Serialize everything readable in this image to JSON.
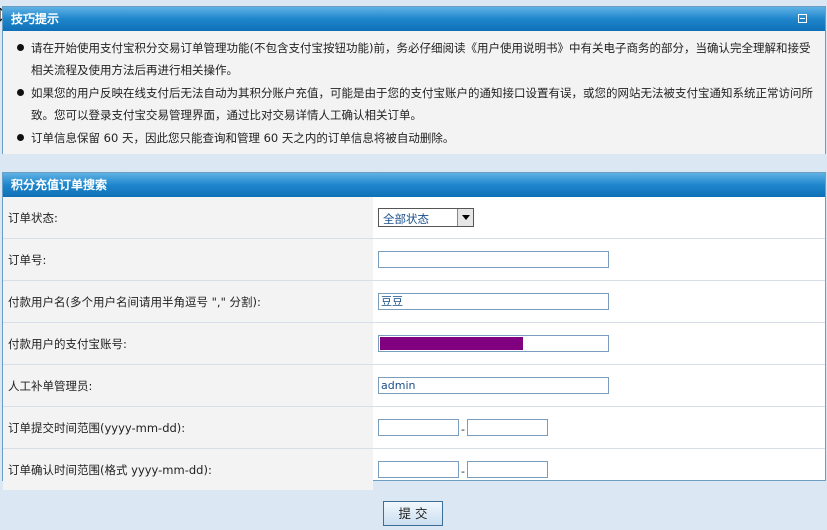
{
  "tips_panel": {
    "title": "技巧提示",
    "items": [
      "请在开始使用支付宝积分交易订单管理功能(不包含支付宝按钮功能)前，务必仔细阅读《用户使用说明书》中有关电子商务的部分，当确认完全理解和接受相关流程及使用方法后再进行相关操作。",
      "如果您的用户反映在线支付后无法自动为其积分账户充值，可能是由于您的支付宝账户的通知接口设置有误，或您的网站无法被支付宝通知系统正常访问所致。您可以登录支付宝交易管理界面，通过比对交易详情人工确认相关订单。",
      "订单信息保留  60 天，因此您只能查询和管理  60 天之内的订单信息将被自动删除。"
    ]
  },
  "search_panel": {
    "title": "积分充值订单搜索",
    "order_status": {
      "label": "订单状态:",
      "selected": "全部状态"
    },
    "order_no": {
      "label": "订单号:",
      "value": ""
    },
    "payer_name": {
      "label": "付款用户名(多个用户名间请用半角逗号 \",\" 分割):",
      "value": "豆豆"
    },
    "payer_alipay": {
      "label": "付款用户的支付宝账号:",
      "value": ""
    },
    "manual_admin": {
      "label": "人工补单管理员:",
      "value": "admin"
    },
    "submit_time_range": {
      "label": "订单提交时间范围(yyyy-mm-dd):",
      "from": "",
      "separator": "-",
      "to": ""
    },
    "confirm_time_range": {
      "label": "订单确认时间范围(格式  yyyy-mm-dd):",
      "from": "",
      "separator": "-",
      "to": ""
    }
  },
  "submit_label": "提交"
}
